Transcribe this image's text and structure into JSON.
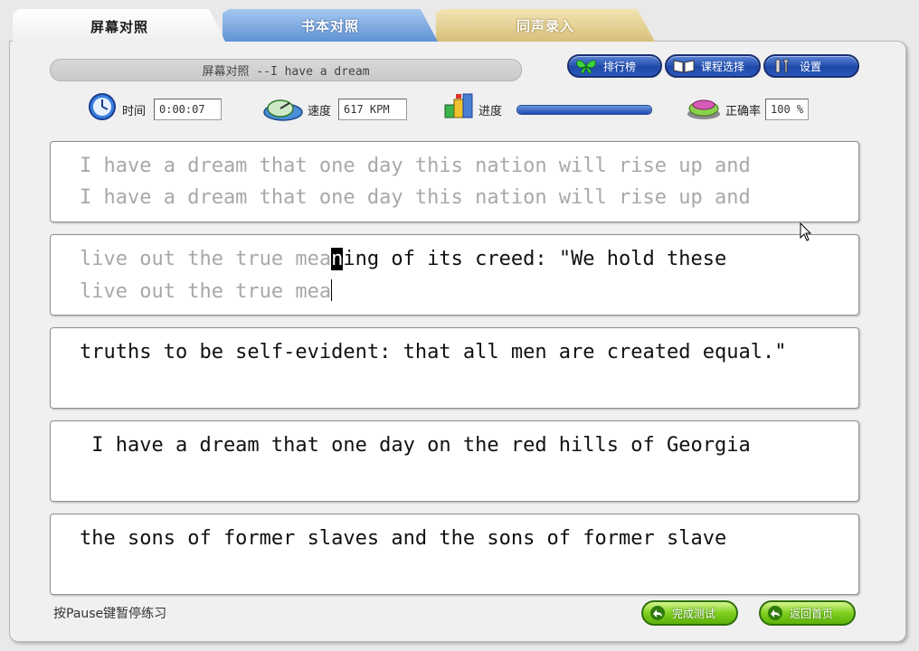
{
  "tabs": [
    {
      "label": "屏幕对照",
      "active": true
    },
    {
      "label": "书本对照",
      "active": false
    },
    {
      "label": "同声录入",
      "active": false
    }
  ],
  "title": "屏幕对照 --I have a dream",
  "toolbar": {
    "ranking_label": "排行榜",
    "course_label": "课程选择",
    "settings_label": "设置"
  },
  "stats": {
    "time_label": "时间",
    "time_value": "0:00:07",
    "speed_label": "速度",
    "speed_value": "617 KPM",
    "progress_label": "进度",
    "progress_fraction": 1.0,
    "accuracy_label": "正确率",
    "accuracy_value": "100 %"
  },
  "practice": {
    "box1": {
      "source": "I have a dream that one day this nation will rise up and",
      "typed": "I have a dream that one day this nation will rise up and"
    },
    "box2": {
      "source_done": "live out the true mea",
      "source_current": "n",
      "source_rest": "ing of its creed: \"We hold these",
      "typed": "live out the true mea"
    },
    "box3": {
      "source": "truths to be self-evident: that all men are created equal.\""
    },
    "box4": {
      "source": " I have a dream that one day on the red hills of Georgia"
    },
    "box5": {
      "source": "the sons of former slaves and the sons of former slave"
    }
  },
  "footer": {
    "hint": "按Pause键暂停练习",
    "finish_label": "完成测试",
    "home_label": "返回首页"
  },
  "colors": {
    "accent_blue": "#1f49a8",
    "accent_green": "#5eb10b",
    "done_text": "#a8a8a8"
  }
}
